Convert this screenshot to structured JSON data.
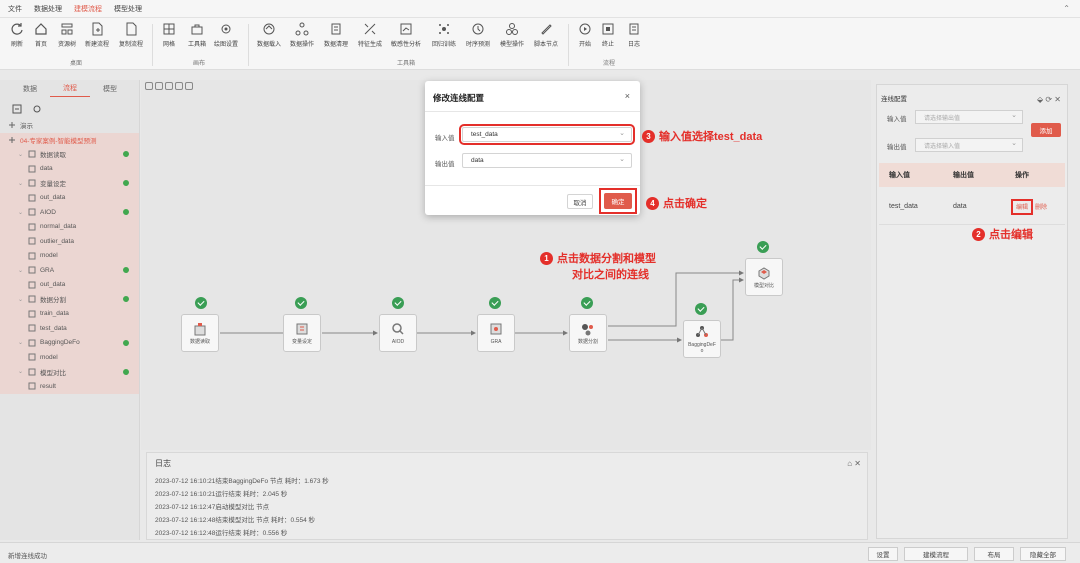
{
  "menu": [
    "文件",
    "数据处理",
    "建模流程",
    "模型处理"
  ],
  "menu_active": 2,
  "ribbon": {
    "buttons": [
      {
        "label": "刷新",
        "icon": "refresh-icon"
      },
      {
        "label": "首页",
        "icon": "home-icon"
      },
      {
        "label": "资源树",
        "icon": "tree-icon"
      },
      {
        "label": "新建流程",
        "icon": "new-flow-icon"
      },
      {
        "label": "复制流程",
        "icon": "copy-flow-icon"
      },
      {
        "label": "网格",
        "icon": "grid-icon"
      },
      {
        "label": "工具箱",
        "icon": "toolbox-icon"
      },
      {
        "label": "绘图设置",
        "icon": "settings-icon"
      },
      {
        "label": "数据载入",
        "icon": "data-load-icon"
      },
      {
        "label": "数据操作",
        "icon": "data-op-icon"
      },
      {
        "label": "数据清理",
        "icon": "data-clean-icon"
      },
      {
        "label": "特征生成",
        "icon": "feature-icon"
      },
      {
        "label": "敏感性分析",
        "icon": "sensitivity-icon"
      },
      {
        "label": "回归训练",
        "icon": "regression-icon"
      },
      {
        "label": "时序预测",
        "icon": "timeseries-icon"
      },
      {
        "label": "模型操作",
        "icon": "model-op-icon"
      },
      {
        "label": "脚本节点",
        "icon": "script-icon"
      },
      {
        "label": "开始",
        "icon": "play-icon"
      },
      {
        "label": "终止",
        "icon": "stop-icon"
      },
      {
        "label": "日志",
        "icon": "log-icon"
      }
    ],
    "groups": [
      "桌面",
      "画布",
      "工具箱",
      "流程"
    ]
  },
  "left_panel": {
    "tabs": [
      "数据",
      "流程",
      "模型"
    ],
    "active_tab": 1,
    "tree": [
      {
        "label": "演示",
        "level": 0,
        "hl": false,
        "dot": false
      },
      {
        "label": "04-专家案例-智能模型预测",
        "level": 0,
        "hl": true,
        "dot": false,
        "accent": true
      },
      {
        "label": "数据读取",
        "level": 1,
        "hl": true,
        "dot": true
      },
      {
        "label": "data",
        "level": 2,
        "hl": true,
        "dot": false
      },
      {
        "label": "变量设定",
        "level": 1,
        "hl": true,
        "dot": true
      },
      {
        "label": "out_data",
        "level": 2,
        "hl": true,
        "dot": false
      },
      {
        "label": "AIOD",
        "level": 1,
        "hl": true,
        "dot": true
      },
      {
        "label": "normal_data",
        "level": 2,
        "hl": true,
        "dot": false
      },
      {
        "label": "outlier_data",
        "level": 2,
        "hl": true,
        "dot": false
      },
      {
        "label": "model",
        "level": 2,
        "hl": true,
        "dot": false
      },
      {
        "label": "GRA",
        "level": 1,
        "hl": true,
        "dot": true
      },
      {
        "label": "out_data",
        "level": 2,
        "hl": true,
        "dot": false
      },
      {
        "label": "数据分割",
        "level": 1,
        "hl": true,
        "dot": true
      },
      {
        "label": "train_data",
        "level": 2,
        "hl": true,
        "dot": false
      },
      {
        "label": "test_data",
        "level": 2,
        "hl": true,
        "dot": false
      },
      {
        "label": "BaggingDeFo",
        "level": 1,
        "hl": true,
        "dot": true
      },
      {
        "label": "model",
        "level": 2,
        "hl": true,
        "dot": false
      },
      {
        "label": "模型对比",
        "level": 1,
        "hl": true,
        "dot": true
      },
      {
        "label": "result",
        "level": 2,
        "hl": true,
        "dot": false
      }
    ]
  },
  "canvas": {
    "nodes": [
      {
        "id": "n1",
        "label": "数据读取"
      },
      {
        "id": "n2",
        "label": "变量设定"
      },
      {
        "id": "n3",
        "label": "AIOD"
      },
      {
        "id": "n4",
        "label": "GRA"
      },
      {
        "id": "n5",
        "label": "数据分割"
      },
      {
        "id": "n6",
        "label": "BaggingDeFo"
      },
      {
        "id": "n7",
        "label": "模型对比"
      }
    ]
  },
  "callouts": {
    "c1_num": "1",
    "c1_line1": "点击数据分割和模型",
    "c1_line2": "对比之间的连线",
    "c2_num": "2",
    "c2_text": "点击编辑",
    "c3_num": "3",
    "c3_text": "输入值选择test_data",
    "c4_num": "4",
    "c4_text": "点击确定"
  },
  "dialog": {
    "title": "修改连线配置",
    "close": "×",
    "input_label": "输入值",
    "input_value": "test_data",
    "output_label": "输出值",
    "output_value": "data",
    "cancel": "取消",
    "ok": "确定"
  },
  "right_panel": {
    "title": "连线配置",
    "input_label": "输入值",
    "input_placeholder": "请选择输出值",
    "output_label": "输出值",
    "output_placeholder": "请选择输入值",
    "add": "添加",
    "col_input": "输入值",
    "col_output": "输出值",
    "col_action": "操作",
    "row_input": "test_data",
    "row_output": "data",
    "edit": "编辑",
    "delete": "删除"
  },
  "log": {
    "title": "日志",
    "lines": [
      "2023-07-12 16:10:21结束BaggingDeFo 节点 耗时：1.673 秒",
      "2023-07-12 16:10:21运行结束 耗时：2.045 秒",
      "2023-07-12 16:12:47启动模型对比 节点",
      "2023-07-12 16:12:48结束模型对比 节点 耗时：0.554 秒",
      "2023-07-12 16:12:48运行结束 耗时：0.556 秒"
    ]
  },
  "status": {
    "text": "新增连线成功",
    "buttons": [
      "设置",
      "建模流程",
      "布局",
      "隐藏全部"
    ]
  },
  "colors": {
    "accent": "#e05b4b",
    "success": "#3a9e55",
    "annotation": "#e42f2a"
  }
}
